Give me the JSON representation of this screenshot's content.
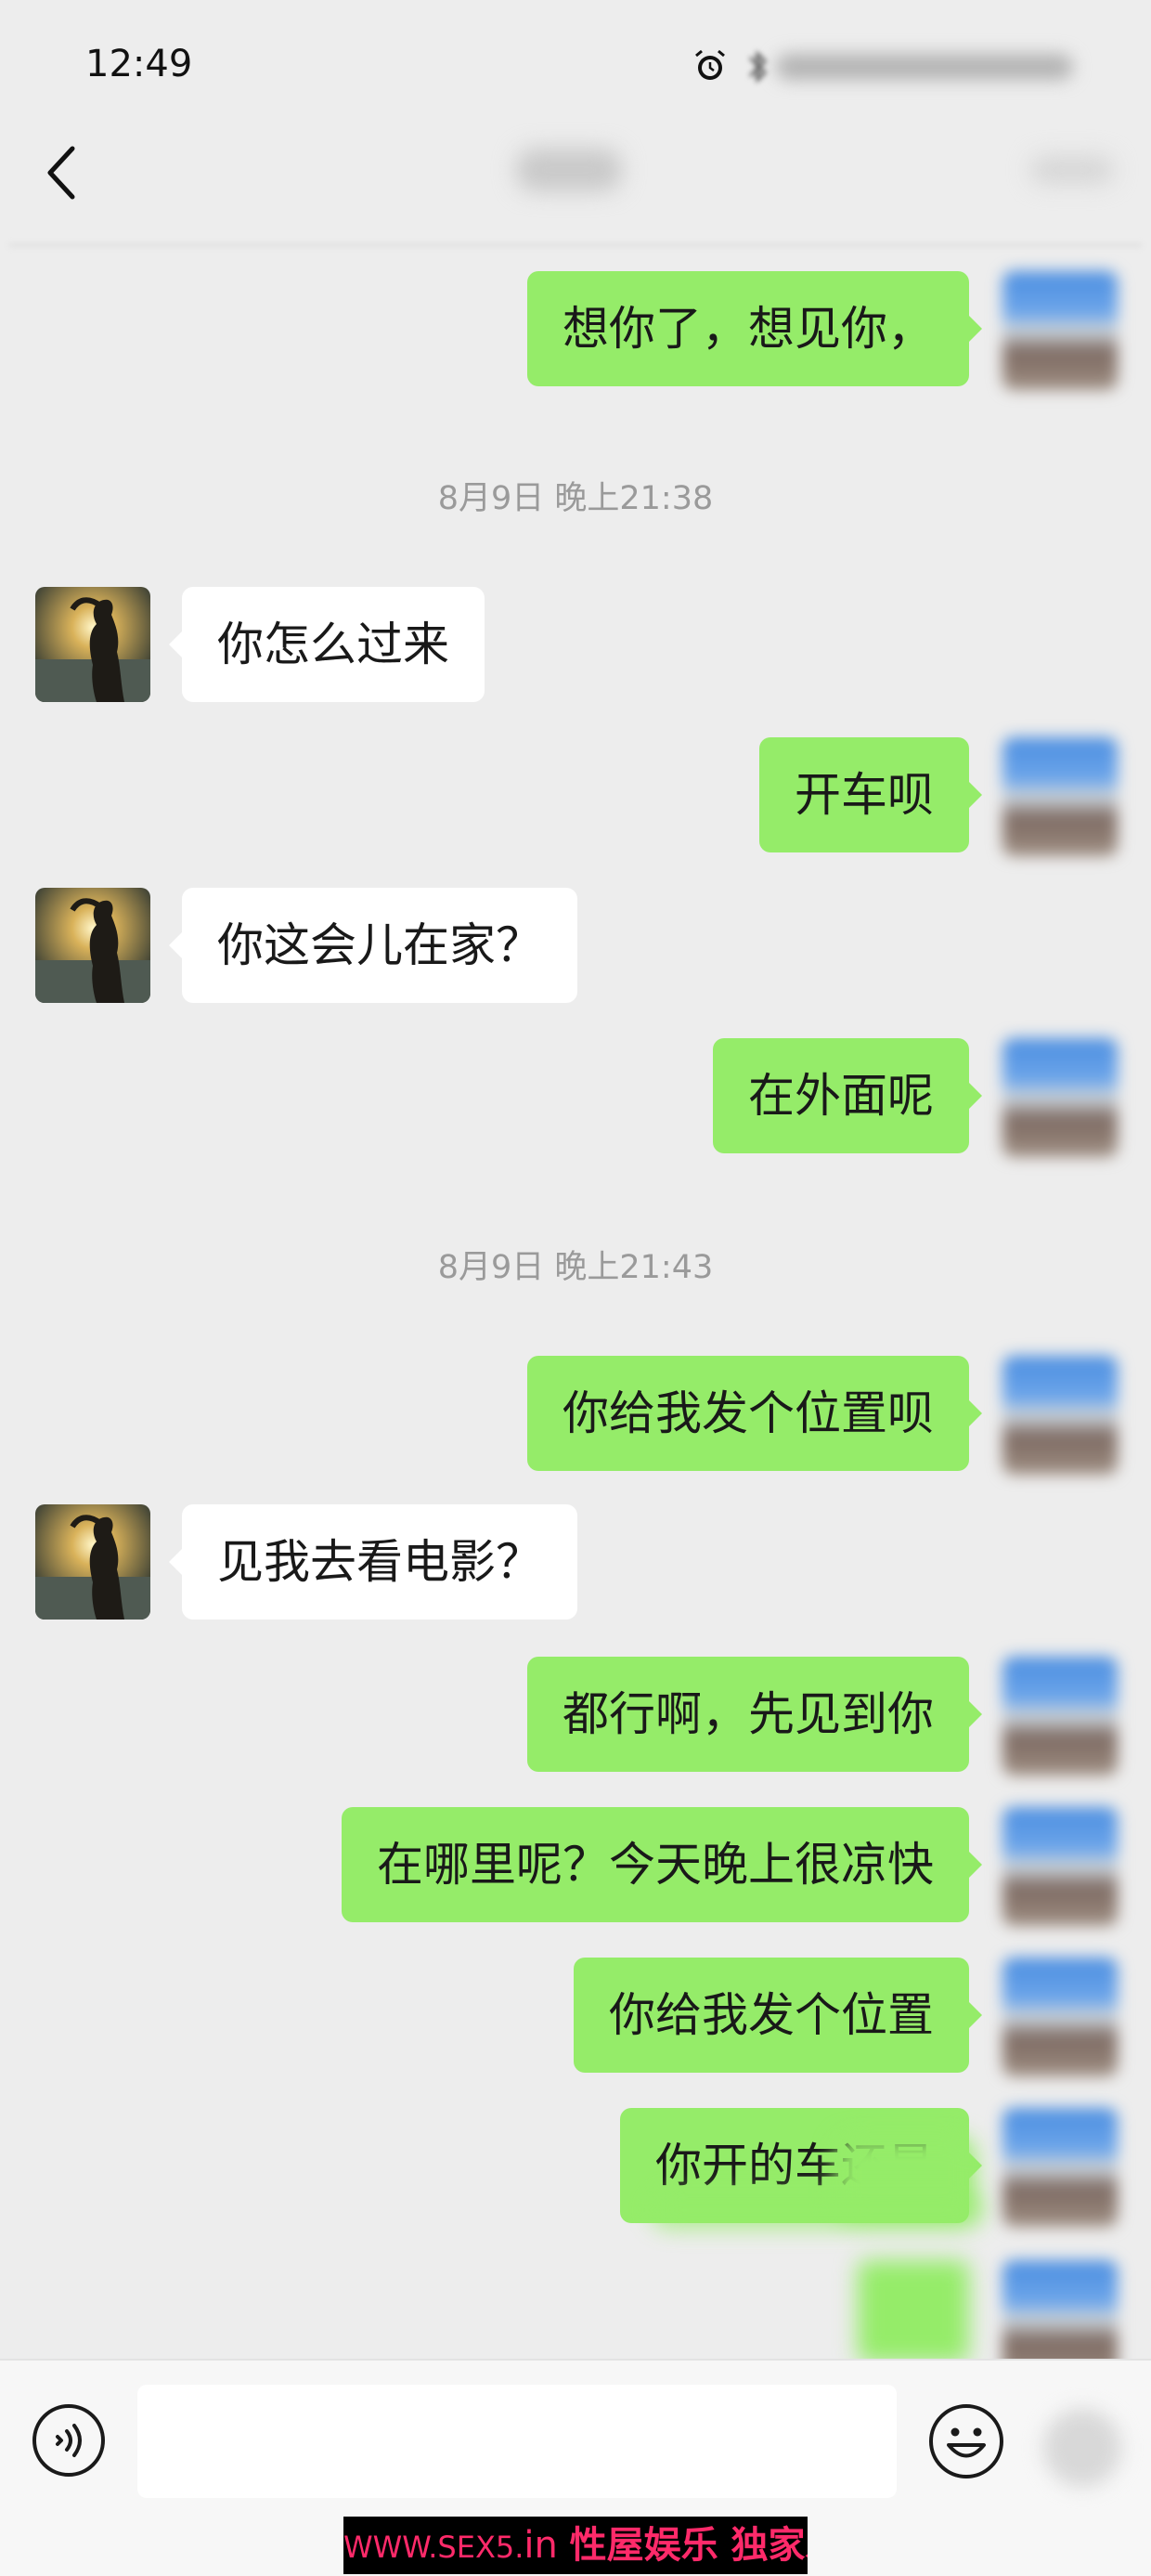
{
  "status_bar": {
    "time": "12:49",
    "icons": [
      "alarm-icon",
      "bluetooth-icon"
    ]
  },
  "nav": {
    "back_icon": "chevron-left-icon"
  },
  "timestamps": [
    "8月9日 晚上21:38",
    "8月9日 晚上21:43"
  ],
  "messages": {
    "m1": "想你了，想见你，",
    "m2": "你怎么过来",
    "m3": "开车呗",
    "m4": "你这会儿在家？",
    "m5": "在外面呢",
    "m6": "你给我发个位置呗",
    "m7": "见我去看电影？",
    "m8": "都行啊，先见到你",
    "m9": "在哪里呢？今天晚上很凉快",
    "m10": "你给我发个位置",
    "m11": "你开的车还是"
  },
  "input_bar": {
    "voice_icon": "voice-icon",
    "emoji_icon": "emoji-icon",
    "plus_icon": "plus-icon"
  },
  "watermark": {
    "url": "WWW.SEX5.",
    "tld": "in",
    "text": "性屋娱乐 独家发布"
  },
  "colors": {
    "background": "#ededed",
    "outgoing_bubble": "#95ec69",
    "incoming_bubble": "#ffffff",
    "timestamp_text": "#9a9a9a",
    "watermark_text": "#ff2a6a"
  }
}
